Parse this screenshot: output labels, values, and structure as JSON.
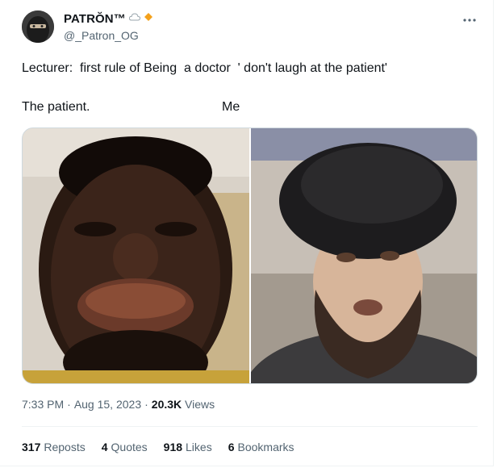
{
  "author": {
    "display_name": "PATRŎN™",
    "handle": "@_Patron_OG"
  },
  "tweet": {
    "line1": "Lecturer:  first rule of Being  a doctor  ' don't laugh at the patient'",
    "caption_left": "The patient.",
    "caption_right": "Me"
  },
  "meta": {
    "time": "7:33 PM",
    "separator1": "·",
    "date": "Aug 15, 2023",
    "separator2": "·",
    "views_count": "20.3K",
    "views_label": "Views"
  },
  "stats": {
    "reposts_count": "317",
    "reposts_label": "Reposts",
    "quotes_count": "4",
    "quotes_label": "Quotes",
    "likes_count": "918",
    "likes_label": "Likes",
    "bookmarks_count": "6",
    "bookmarks_label": "Bookmarks"
  },
  "more_icon": "more-horizontal-icon",
  "colors": {
    "text": "#0f1419",
    "muted": "#536471",
    "border": "#eff3f4",
    "badge": "#f4a11b"
  }
}
